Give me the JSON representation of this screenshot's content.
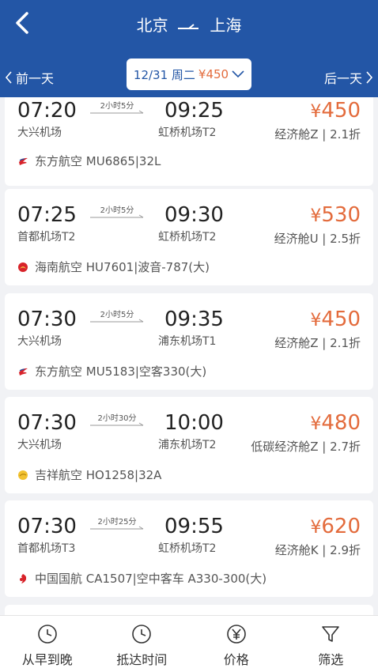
{
  "header": {
    "from": "北京",
    "to": "上海",
    "prev_day": "前一天",
    "next_day": "后一天",
    "date": "12/31 周二",
    "date_price": "¥450",
    "bg_color": "#2356a6"
  },
  "flights": [
    {
      "dep": "07:20",
      "dep_airport": "大兴机场",
      "duration": "2小时5分",
      "arr": "09:25",
      "arr_airport": "虹桥机场T2",
      "price": "450",
      "cabin": "经济舱Z | 2.1折",
      "airline": "东方航空 MU6865|32L",
      "logo": "china-eastern-logo-icon"
    },
    {
      "dep": "07:25",
      "dep_airport": "首都机场T2",
      "duration": "2小时5分",
      "arr": "09:30",
      "arr_airport": "虹桥机场T2",
      "price": "530",
      "cabin": "经济舱U | 2.5折",
      "airline": "海南航空 HU7601|波音-787(大)",
      "logo": "hainan-airlines-logo-icon"
    },
    {
      "dep": "07:30",
      "dep_airport": "大兴机场",
      "duration": "2小时5分",
      "arr": "09:35",
      "arr_airport": "浦东机场T1",
      "price": "450",
      "cabin": "经济舱Z | 2.1折",
      "airline": "东方航空 MU5183|空客330(大)",
      "logo": "china-eastern-logo-icon"
    },
    {
      "dep": "07:30",
      "dep_airport": "大兴机场",
      "duration": "2小时30分",
      "arr": "10:00",
      "arr_airport": "浦东机场T2",
      "price": "480",
      "cabin": "低碳经济舱Z | 2.7折",
      "airline": "吉祥航空 HO1258|32A",
      "logo": "juneyao-logo-icon"
    },
    {
      "dep": "07:30",
      "dep_airport": "首都机场T3",
      "duration": "2小时25分",
      "arr": "09:55",
      "arr_airport": "虹桥机场T2",
      "price": "620",
      "cabin": "经济舱K | 2.9折",
      "airline": "中国国航 CA1507|空中客车 A330-300(大)",
      "logo": "air-china-logo-icon"
    }
  ],
  "currency": "¥",
  "price_color": "#e36b3c",
  "bottom_tabs": [
    {
      "label": "从早到晚",
      "icon": "clock-icon"
    },
    {
      "label": "抵达时间",
      "icon": "clock-icon"
    },
    {
      "label": "价格",
      "icon": "yen-icon"
    },
    {
      "label": "筛选",
      "icon": "filter-icon"
    }
  ]
}
